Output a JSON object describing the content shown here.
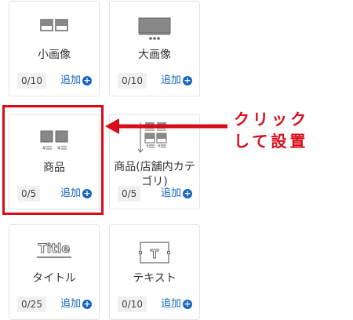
{
  "cards": [
    {
      "label": "小画像",
      "count": "0/10",
      "add_label": "追加",
      "icon": "small-image-icon"
    },
    {
      "label": "大画像",
      "count": "0/10",
      "add_label": "追加",
      "icon": "large-image-icon"
    },
    {
      "label": "商品",
      "count": "0/5",
      "add_label": "追加",
      "icon": "product-icon"
    },
    {
      "label": "商品(店舗内カテゴリ)",
      "count": "0/5",
      "add_label": "追加",
      "icon": "product-category-icon"
    },
    {
      "label": "タイトル",
      "count": "0/25",
      "add_label": "追加",
      "icon": "title-icon",
      "icon_text": "Title"
    },
    {
      "label": "テキスト",
      "count": "0/10",
      "add_label": "追加",
      "icon": "text-icon",
      "icon_text": "T"
    }
  ],
  "callout": {
    "line1": "クリック",
    "line2": "して設置"
  },
  "colors": {
    "accent_red": "#d80c18",
    "add_blue": "#1565c0"
  }
}
